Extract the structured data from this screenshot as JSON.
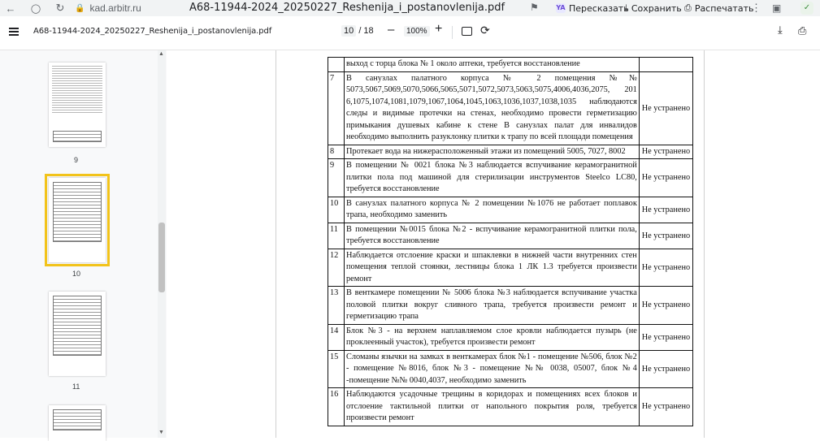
{
  "browser": {
    "domain": "kad.arbitr.ru",
    "tab_title": "A68-11944-2024_20250227_Reshenija_i_postanovlenija.pdf",
    "actions": {
      "send_label": "Пересказать",
      "save_label": "Сохранить",
      "print_label": "Распечатать"
    },
    "badge": "YA"
  },
  "toolbar": {
    "file_name": "A68-11944-2024_20250227_Reshenija_i_postanovlenija.pdf",
    "current_page": "10",
    "total_pages": "/ 18",
    "zoom": "100%"
  },
  "sidebar": {
    "thumbnails": [
      {
        "label": "9"
      },
      {
        "label": "10"
      },
      {
        "label": "11"
      }
    ],
    "active": "10"
  },
  "document": {
    "rows": [
      {
        "num": "",
        "text": "выход с торца блока № 1 около аптеки, требуется восстановление",
        "status": ""
      },
      {
        "num": "7",
        "text": "В санузлах палатного корпуса № 2 помещения №№ 5073,5067,5069,5070,5066,5065,5071,5072,5073,5063,5075,4006,4036,2075, 201 6,1075,1074,1081,1079,1067,1064,1045,1063,1036,1037,1038,1035 наблюдаются следы и видимые протечки на стенах, необходимо провести герметизацию примыкания душевых кабине к стене В санузлах палат для инвалидов необходимо выполнить разуклонку плитки к трапу по всей площади помещения",
        "status": "Не устранено"
      },
      {
        "num": "8",
        "text": "Протекает вода на нижерасположенный этажи из помещений 5005, 7027, 8002",
        "status": "Не устранено"
      },
      {
        "num": "9",
        "text": "В помещении № 0021 блока №3 наблюдается вспучивание керамогранитной плитки пола под машиной для стерилизации инструментов Steelco LC80, требуется восстановление",
        "status": "Не устранено"
      },
      {
        "num": "10",
        "text": "В санузлах палатного корпуса № 2 помещении №1076 не работает поплавок трапа, необходимо заменить",
        "status": "Не устранено"
      },
      {
        "num": "11",
        "text": "В помещении №0015 блока №2 - вспучивание керамогранитной плитки пола, требуется восстановление",
        "status": "Не устранено"
      },
      {
        "num": "12",
        "text": "Наблюдается отслоение краски и шпаклевки в нижней части внутренних стен помещения теплой стоянки, лестницы блока 1 ЛК 1.3 требуется произвести ремонт",
        "status": "Не устранено"
      },
      {
        "num": "13",
        "text": "В венткамере помещении № 5006 блока №3 наблюдается вспучивание участка половой плитки вокруг сливного трапа, требуется произвести ремонт и герметизацию трапа",
        "status": "Не устранено"
      },
      {
        "num": "14",
        "text": "Блок №3 - на верхнем наплавляемом слое кровли наблюдается пузырь (не проклеенный участок), требуется произвести ремонт",
        "status": "Не устранено"
      },
      {
        "num": "15",
        "text": "Сломаны язычки на замках в венткамерах блок №1 - помещение №506, блок №2 - помещение №8016, блок №3 - помещение №№ 0038, 05007, блок №4 -помещение №№ 0040,4037, необходимо заменить",
        "status": "Не устранено"
      },
      {
        "num": "16",
        "text": "Наблюдаются усадочные трещины в коридорах и помещениях всех блоков и отслоение тактильной плитки от напольного покрытия роля, требуется произвести ремонт",
        "status": "Не устранено"
      }
    ]
  }
}
